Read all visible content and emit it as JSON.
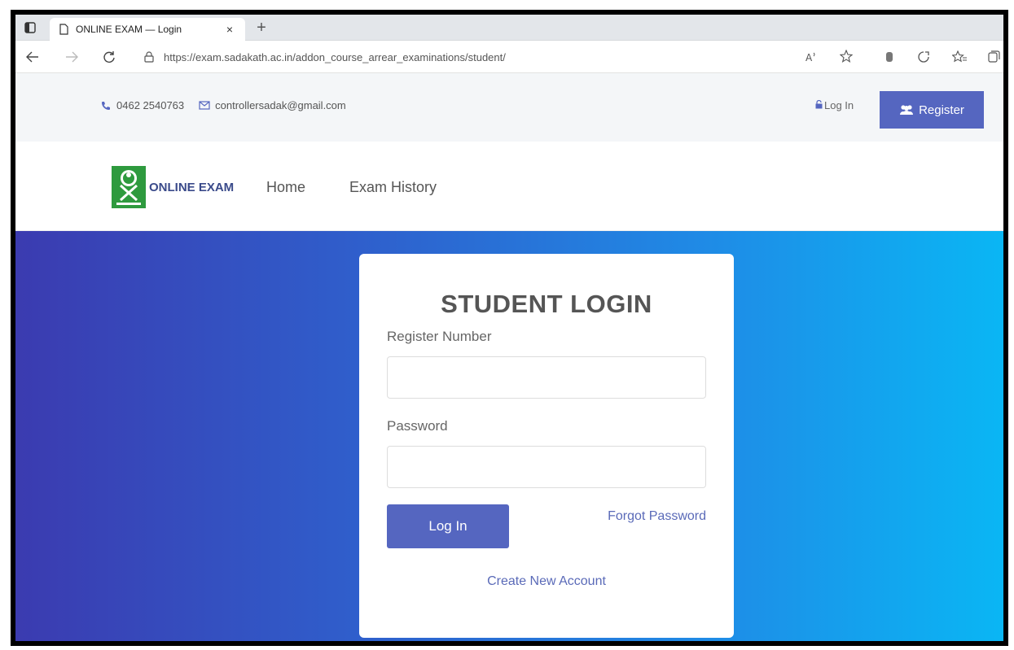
{
  "browser": {
    "tab_title": "ONLINE EXAM — Login",
    "tab_close": "×",
    "new_tab": "+",
    "url": "https://exam.sadakath.ac.in/addon_course_arrear_examinations/student/"
  },
  "topbar": {
    "phone": "0462 2540763",
    "email": "controllersadak@gmail.com",
    "login_label": "Log In",
    "register_label": "Register"
  },
  "navbar": {
    "brand": "ONLINE EXAM",
    "links": [
      "Home",
      "Exam History"
    ]
  },
  "login_form": {
    "title": "STUDENT LOGIN",
    "register_number_label": "Register Number",
    "register_number_value": "",
    "password_label": "Password",
    "password_value": "",
    "submit_label": "Log In",
    "forgot_label": "Forgot Password",
    "create_label": "Create New Account"
  },
  "colors": {
    "accent": "#5566c0",
    "hero_start": "#3b3bb0",
    "hero_end": "#0ab6f4",
    "logo_green": "#2e9a3e"
  },
  "icons": [
    "window-icon",
    "page-icon",
    "back-icon",
    "forward-icon",
    "refresh-icon",
    "lock-icon",
    "read-aloud-icon",
    "favorite-add-icon",
    "extension-icon",
    "sync-icon",
    "favorites-icon",
    "collections-icon",
    "phone-icon",
    "mail-icon",
    "lock-small-icon",
    "users-icon"
  ]
}
